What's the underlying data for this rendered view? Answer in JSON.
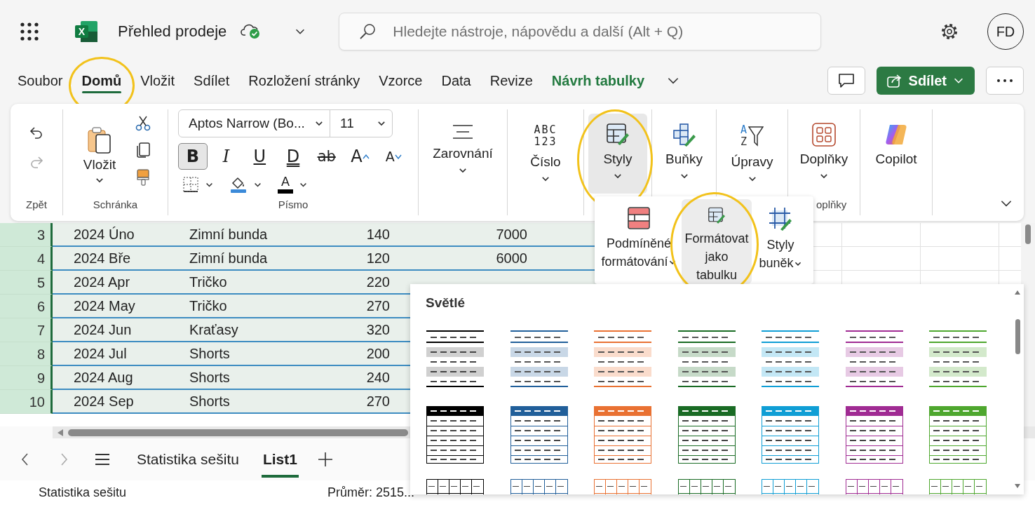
{
  "app_bar": {
    "logo_letter": "X",
    "title": "Přehled prodeje",
    "search": {
      "placeholder": "Hledejte nástroje, nápovědu a další (Alt + Q)"
    },
    "avatar": "FD"
  },
  "tabs": [
    {
      "label": "Soubor",
      "kind": "plain",
      "selected": false,
      "circled": false
    },
    {
      "label": "Domů",
      "kind": "plain",
      "selected": true,
      "circled": true
    },
    {
      "label": "Vložit",
      "kind": "plain",
      "selected": false,
      "circled": false
    },
    {
      "label": "Sdílet",
      "kind": "plain",
      "selected": false,
      "circled": false
    },
    {
      "label": "Rozložení stránky",
      "kind": "plain",
      "selected": false,
      "circled": false
    },
    {
      "label": "Vzorce",
      "kind": "plain",
      "selected": false,
      "circled": false
    },
    {
      "label": "Data",
      "kind": "plain",
      "selected": false,
      "circled": false
    },
    {
      "label": "Revize",
      "kind": "plain",
      "selected": false,
      "circled": false
    },
    {
      "label": "Návrh tabulky",
      "kind": "contextual",
      "selected": false,
      "circled": false
    }
  ],
  "share_button": "Sdílet",
  "ribbon": {
    "undo_group": {
      "label": "Zpět",
      "redo_disabled": true
    },
    "clipboard": {
      "label": "Schránka",
      "paste": "Vložit"
    },
    "font": {
      "label": "Písmo",
      "name": "Aptos Narrow (Bo...",
      "size": "11",
      "color_glyph": "A",
      "buttons": [
        {
          "kind": "bold",
          "glyph": "B",
          "pressed": true
        },
        {
          "kind": "italic",
          "glyph": "I",
          "pressed": false
        },
        {
          "kind": "underline",
          "glyph": "U",
          "pressed": false
        },
        {
          "kind": "double-underline",
          "glyph": "D",
          "pressed": false
        },
        {
          "kind": "strikethrough",
          "glyph": "ab",
          "pressed": false
        },
        {
          "kind": "grow",
          "glyph": "A",
          "pressed": false
        },
        {
          "kind": "shrink",
          "glyph": "A",
          "pressed": false
        }
      ]
    },
    "commands": [
      {
        "kind": "align",
        "label": "Zarovnání",
        "dropdown": true,
        "selected": false,
        "circled": false
      },
      {
        "kind": "number",
        "label": "Číslo",
        "glyph_lines": [
          "ABC",
          "123"
        ],
        "dropdown": true,
        "selected": false,
        "circled": false
      },
      {
        "kind": "styles",
        "label": "Styly",
        "dropdown": true,
        "selected": true,
        "circled": true
      },
      {
        "kind": "cells",
        "label": "Buňky",
        "dropdown": true,
        "selected": false,
        "circled": false
      },
      {
        "kind": "editing",
        "label": "Úpravy",
        "glyph_lines": [
          "A",
          "Z"
        ],
        "dropdown": true,
        "selected": false,
        "circled": false
      },
      {
        "kind": "addins",
        "label": "Doplňky",
        "dropdown": true,
        "selected": false,
        "circled": false
      },
      {
        "kind": "copilot",
        "label": "Copilot",
        "dropdown": false,
        "selected": false,
        "circled": false
      }
    ],
    "addins_group_label": "oplňky"
  },
  "grid": {
    "rows": [
      {
        "number": "3",
        "selected": true,
        "cells": [
          "2024 Úno",
          "Zimní bunda",
          "140",
          "7000"
        ]
      },
      {
        "number": "4",
        "selected": true,
        "cells": [
          "2024 Bře",
          "Zimní bunda",
          "120",
          "6000"
        ]
      },
      {
        "number": "5",
        "selected": true,
        "cells": [
          "2024 Apr",
          "Tričko",
          "220"
        ]
      },
      {
        "number": "6",
        "selected": true,
        "cells": [
          "2024 May",
          "Tričko",
          "270"
        ]
      },
      {
        "number": "7",
        "selected": true,
        "cells": [
          "2024 Jun",
          "Kraťasy",
          "320"
        ]
      },
      {
        "number": "8",
        "selected": true,
        "cells": [
          "2024 Jul",
          "Shorts",
          "200"
        ]
      },
      {
        "number": "9",
        "selected": true,
        "cells": [
          "2024 Aug",
          "Shorts",
          "240"
        ]
      },
      {
        "number": "10",
        "selected": true,
        "cells": [
          "2024 Sep",
          "Shorts",
          "270"
        ]
      }
    ]
  },
  "sheet_tabs": [
    {
      "label": "Statistika sešitu",
      "selected": false
    },
    {
      "label": "List1",
      "selected": true
    }
  ],
  "status_bar": {
    "left": "Statistika sešitu",
    "average": "Průměr: 2515..."
  },
  "styles_menu": {
    "items": [
      {
        "kind": "conditional",
        "label": "Podmíněné formátování",
        "dropdown": true,
        "selected": false,
        "circled": false
      },
      {
        "kind": "table",
        "label": "Formátovat jako tabulku",
        "dropdown": false,
        "selected": true,
        "circled": true
      },
      {
        "kind": "cell-styles",
        "label": "Styly buněk",
        "dropdown": true,
        "selected": false,
        "circled": false
      }
    ]
  },
  "gallery": {
    "title": "Světlé",
    "swatches": [
      {
        "kind": "light",
        "color": "#000000"
      },
      {
        "kind": "light",
        "color": "#215f9a"
      },
      {
        "kind": "light",
        "color": "#e97132"
      },
      {
        "kind": "light",
        "color": "#196b24"
      },
      {
        "kind": "light",
        "color": "#0f9ed5"
      },
      {
        "kind": "light",
        "color": "#a02b93"
      },
      {
        "kind": "light",
        "color": "#4ea72e"
      },
      {
        "kind": "header",
        "color": "#000000"
      },
      {
        "kind": "header",
        "color": "#215f9a"
      },
      {
        "kind": "header",
        "color": "#e97132"
      },
      {
        "kind": "header",
        "color": "#196b24"
      },
      {
        "kind": "header",
        "color": "#0f9ed5"
      },
      {
        "kind": "header",
        "color": "#a02b93"
      },
      {
        "kind": "header",
        "color": "#4ea72e"
      },
      {
        "kind": "grid",
        "color": "#000000"
      },
      {
        "kind": "grid",
        "color": "#215f9a"
      },
      {
        "kind": "grid",
        "color": "#e97132"
      },
      {
        "kind": "grid",
        "color": "#196b24"
      },
      {
        "kind": "grid",
        "color": "#0f9ed5"
      },
      {
        "kind": "grid",
        "color": "#a02b93"
      },
      {
        "kind": "grid",
        "color": "#4ea72e"
      }
    ]
  }
}
